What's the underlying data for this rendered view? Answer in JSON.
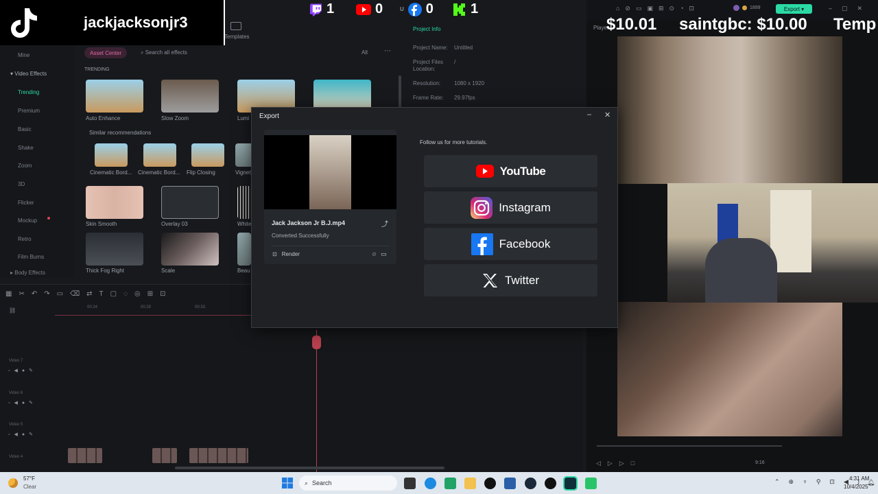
{
  "overlay": {
    "channel_name": "jackjacksonjr3",
    "counters": [
      {
        "platform": "twitch",
        "value": "1"
      },
      {
        "platform": "youtube",
        "value": "0"
      },
      {
        "platform": "facebook",
        "value": "0"
      },
      {
        "platform": "kick",
        "value": "1"
      }
    ],
    "ticker": [
      "$10.01",
      "saintgbc: $10.00",
      "Temp"
    ],
    "counter_prefix": "U"
  },
  "editor": {
    "templates_label": "Templates",
    "asset_center": "Asset Center",
    "search_placeholder": "Search all effects",
    "filter_all": "All",
    "sidebar": {
      "mine": "Mine",
      "video_effects": "Video Effects",
      "items": [
        "Trending",
        "Premium",
        "Basic",
        "Shake",
        "Zoom",
        "3D",
        "Flicker",
        "Mockup",
        "Retro",
        "Film Burns"
      ],
      "body_effects": "Body Effects"
    },
    "trending_heading": "TRENDING",
    "similar_heading": "Similar recommendations",
    "effects_row1": [
      "Auto Enhance",
      "Slow Zoom",
      "Lumi"
    ],
    "effects_row2": [
      "Cinematic Bord...",
      "Cinematic Bord...",
      "Flip Closing",
      "Vignet"
    ],
    "effects_row3": [
      "Skin Smooth",
      "Overlay 03",
      "White"
    ],
    "effects_row4": [
      "Thick Fog Right",
      "Scale",
      "Beau"
    ],
    "project_info": {
      "tab": "Project Info",
      "name_label": "Project Name:",
      "name": "Untitled",
      "files_label": "Project Files Location:",
      "files": "/",
      "res_label": "Resolution:",
      "res": "1080 x 1920",
      "fps_label": "Frame Rate:",
      "fps": "29.97fps"
    },
    "timeline": {
      "ticks": [
        "00:24",
        "00:29",
        "00:33"
      ],
      "tracks": [
        "Video 7",
        "Video 6",
        "Video 5",
        "Video 4"
      ]
    },
    "player_label": "Player",
    "export_button": "Export",
    "coin_count": "1899",
    "player_time": "9:16"
  },
  "export_dialog": {
    "title": "Export",
    "file_name": "Jack Jackson Jr B.J.mp4",
    "status": "Converted Successfully",
    "render_label": "Render",
    "follow_text": "Follow us for more tutorials.",
    "socials": [
      {
        "name": "YouTube",
        "icon": "youtube-icon",
        "color": "#ff0000"
      },
      {
        "name": "Instagram",
        "icon": "instagram-icon",
        "color": "#d6249f"
      },
      {
        "name": "Facebook",
        "icon": "facebook-icon",
        "color": "#1877f2"
      },
      {
        "name": "Twitter",
        "icon": "x-icon",
        "color": "#ffffff"
      }
    ]
  },
  "taskbar": {
    "weather_temp": "57°F",
    "weather_cond": "Clear",
    "search_label": "Search",
    "time": "4:31 AM",
    "date": "10/4/2025"
  }
}
